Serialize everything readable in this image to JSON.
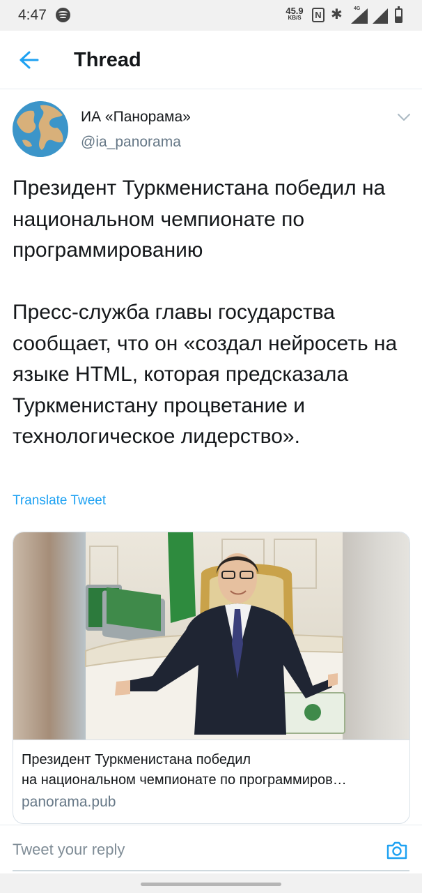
{
  "status_bar": {
    "time": "4:47",
    "net_speed_value": "45.9",
    "net_speed_unit": "KB/S",
    "network_label": "4G",
    "icons": [
      "spotify-icon",
      "nfc-icon",
      "bluetooth-icon",
      "signal-icon",
      "battery-icon"
    ]
  },
  "header": {
    "title": "Thread",
    "back_icon": "arrow-left-icon"
  },
  "tweet": {
    "author_name": "ИА «Панорама»",
    "author_handle": "@ia_panorama",
    "avatar_icon": "globe-icon",
    "menu_icon": "chevron-down-icon",
    "paragraphs": [
      "Президент Туркменистана победил на национальном чемпионате по программированию",
      "Пресс-служба главы государства сообщает, что он «создал нейросеть на языке HTML, которая предсказала Туркменистану процветание и технологическое лидерство»."
    ],
    "translate_label": "Translate Tweet"
  },
  "link_card": {
    "title_line1": "Президент Туркменистана победил",
    "title_line2": "на национальном чемпионате по программиров…",
    "domain": "panorama.pub"
  },
  "reply": {
    "placeholder": "Tweet your reply",
    "camera_icon": "camera-icon"
  },
  "colors": {
    "accent": "#1da1f2",
    "text": "#14171a",
    "secondary_text": "#657786",
    "divider": "#e6ecf0"
  }
}
